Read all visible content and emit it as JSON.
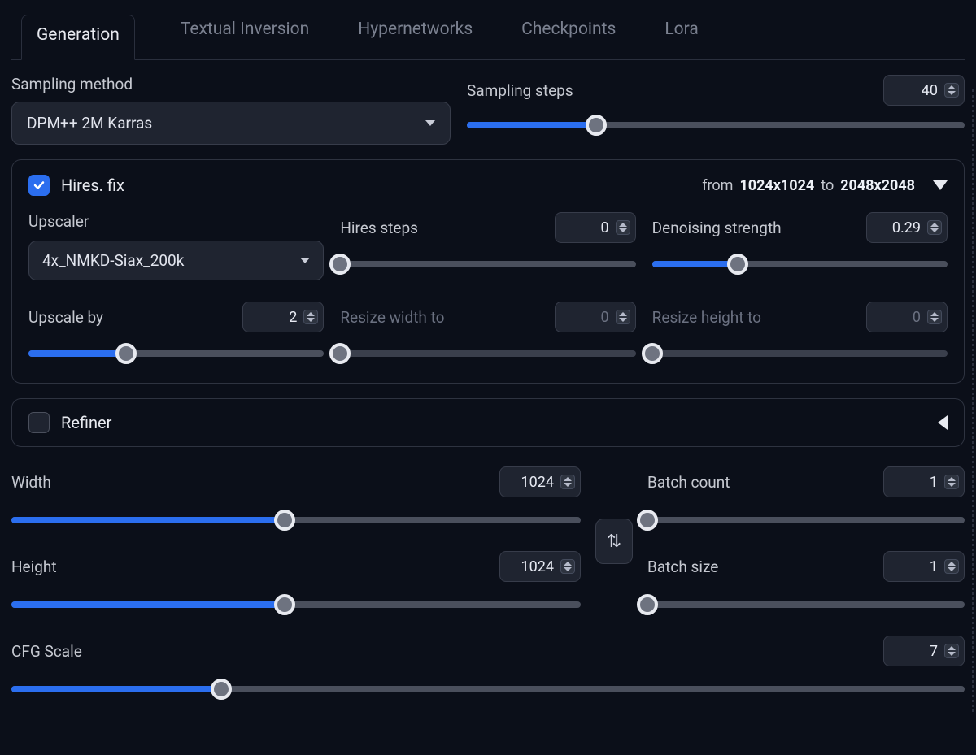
{
  "tabs": [
    "Generation",
    "Textual Inversion",
    "Hypernetworks",
    "Checkpoints",
    "Lora"
  ],
  "active_tab": 0,
  "sampling_method": {
    "label": "Sampling method",
    "value": "DPM++ 2M Karras"
  },
  "sampling_steps": {
    "label": "Sampling steps",
    "value": "40",
    "percent": 26
  },
  "hires": {
    "title": "Hires. fix",
    "checked": true,
    "from_label": "from",
    "from_size": "1024x1024",
    "to_label": "to",
    "to_size": "2048x2048",
    "upscaler": {
      "label": "Upscaler",
      "value": "4x_NMKD-Siax_200k"
    },
    "hires_steps": {
      "label": "Hires steps",
      "value": "0",
      "percent": 0
    },
    "denoising": {
      "label": "Denoising strength",
      "value": "0.29",
      "percent": 29
    },
    "upscale_by": {
      "label": "Upscale by",
      "value": "2",
      "percent": 33
    },
    "resize_w": {
      "label": "Resize width to",
      "value": "0",
      "percent": 0
    },
    "resize_h": {
      "label": "Resize height to",
      "value": "0",
      "percent": 0
    }
  },
  "refiner": {
    "title": "Refiner",
    "checked": false
  },
  "width": {
    "label": "Width",
    "value": "1024",
    "percent": 48
  },
  "height": {
    "label": "Height",
    "value": "1024",
    "percent": 48
  },
  "batch_count": {
    "label": "Batch count",
    "value": "1",
    "percent": 0
  },
  "batch_size": {
    "label": "Batch size",
    "value": "1",
    "percent": 0
  },
  "cfg": {
    "label": "CFG Scale",
    "value": "7",
    "percent": 22
  },
  "swap_glyph": "⇅"
}
